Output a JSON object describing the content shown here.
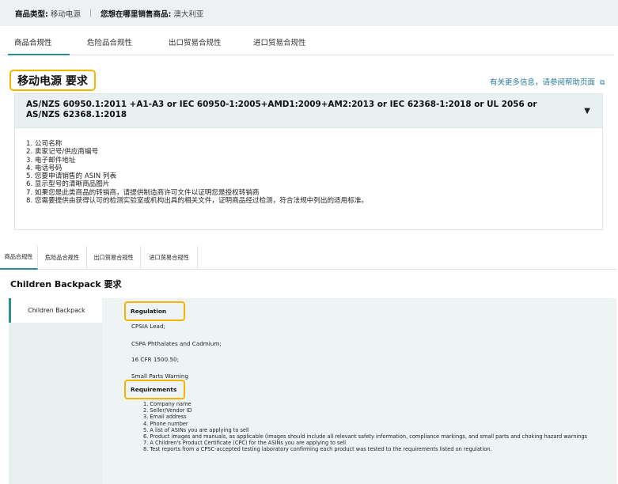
{
  "topbar": {
    "category_label": "商品类型:",
    "category_value": "移动电源",
    "separator": "|",
    "market_label": "您想在哪里销售商品:",
    "market_value": "澳大利亚"
  },
  "tabs1": [
    "商品合规性",
    "危险品合规性",
    "出口贸易合规性",
    "进口贸易合规性"
  ],
  "section1": {
    "title": "移动电源 要求",
    "help_link": "有关更多信息，请参阅帮助页面",
    "standard": "AS/NZS 60950.1:2011 +A1-A3 or IEC 60950-1:2005+AMD1:2009+AM2:2013 or IEC 62368-1:2018 or UL 2056 or AS/NZS 62368.1:2018",
    "caret": "▼",
    "items": [
      "1. 公司名称",
      "2. 卖家记号/供应商编号",
      "3. 电子邮件地址",
      "4. 电话号码",
      "5. 您要申请销售的 ASIN 列表",
      "6. 显示型号的清晰商品图片",
      "7. 如果您是此类商品的转销商，请提供制造商许可文件以证明您是授权转销商",
      "8. 您需要提供由获得认可的检测实验室或机构出具的相关文件，证明商品经过检测，符合法规中列出的适用标准。"
    ]
  },
  "tabs2": [
    "商品合规性",
    "危险品合规性",
    "出口贸易合规性",
    "进口贸易合规性"
  ],
  "section2": {
    "title": "Children Backpack 要求",
    "sidebar_item": "Children Backpack",
    "regulation_label": "Regulation",
    "regulations": [
      "CPSIA Lead;",
      "CSPA Phthalates and Cadmium;",
      "16 CFR 1500.50;",
      "Small Parts Warning"
    ],
    "requirements_label": "Requirements",
    "requirements": [
      "1. Company name",
      "2. Seller/Vendor ID",
      "3. Email address",
      "4. Phone number",
      "5. A list of ASINs you are applying to sell",
      "6. Product images and manuals, as applicable (images should include all relevant safety information, compliance markings, and small parts and choking hazard warnings",
      "7. A Children's Product Certificate (CPC) for the ASINs you are applying to sell",
      "8. Test reports from a CPSC-accepted testing laboratory confirming each product was tested to the requirements listed on regulation."
    ]
  },
  "colors": {
    "accent": "#2e8b97",
    "highlight": "#f5b400",
    "link": "#2a7a9e",
    "topbar_bg": "#eef1f4",
    "panel_bg": "#eef4f4"
  },
  "icons": {
    "external_link": "external-link-icon",
    "expand_caret": "caret-down-icon"
  }
}
